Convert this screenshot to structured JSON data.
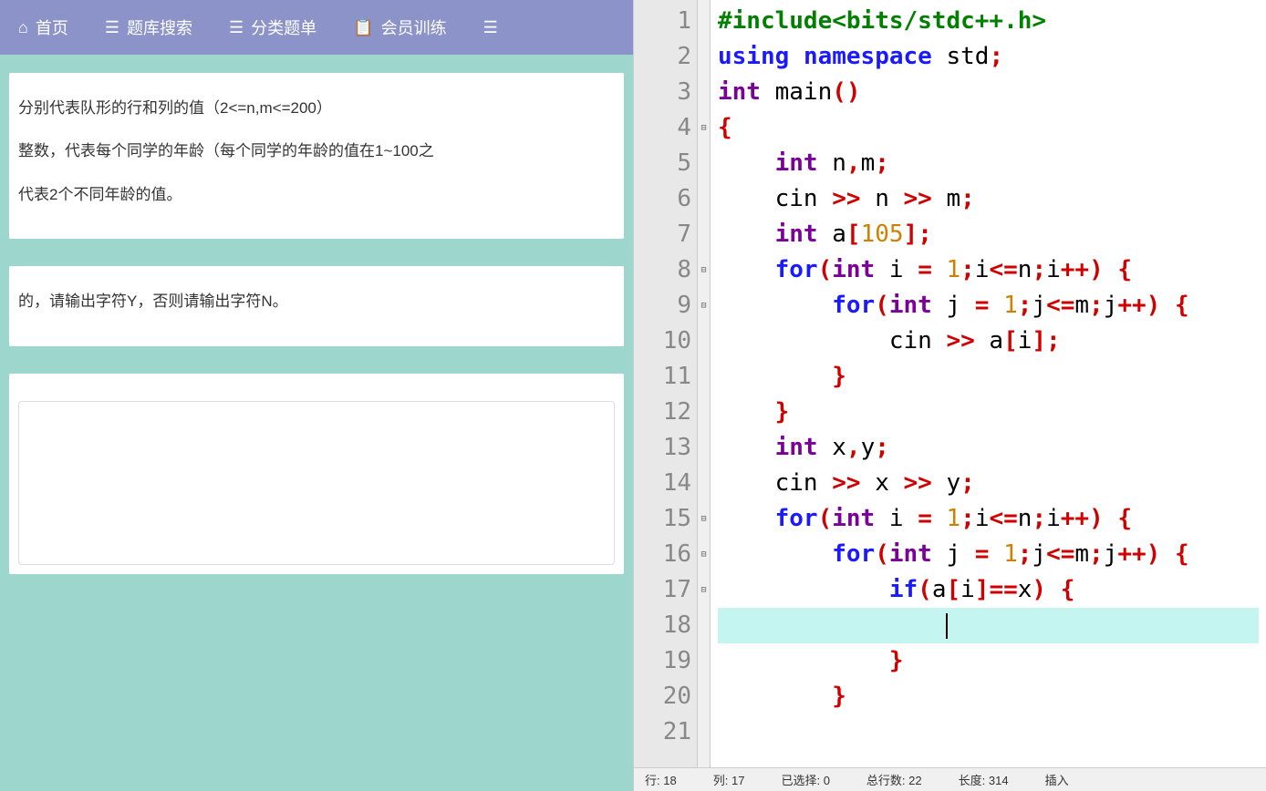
{
  "nav": {
    "items": [
      {
        "icon": "home",
        "label": "首页"
      },
      {
        "icon": "list",
        "label": "题库搜索"
      },
      {
        "icon": "list",
        "label": "分类题单"
      },
      {
        "icon": "calendar",
        "label": "会员训练"
      },
      {
        "icon": "list",
        "label": ""
      }
    ]
  },
  "problem": {
    "desc1": "分别代表队形的行和列的值（2<=n,m<=200）",
    "desc2": "整数，代表每个同学的年龄（每个同学的年龄的值在1~100之",
    "desc3": "代表2个不同年龄的值。",
    "output": "的，请输出字符Y，否则请输出字符N。"
  },
  "code": {
    "lines": [
      {
        "n": "1",
        "fold": "",
        "tokens": [
          [
            "pp",
            "#include"
          ],
          [
            "pp",
            "<bits/stdc++.h>"
          ]
        ]
      },
      {
        "n": "2",
        "fold": "",
        "tokens": [
          [
            "kw",
            "using"
          ],
          [
            "id",
            " "
          ],
          [
            "kw",
            "namespace"
          ],
          [
            "id",
            " std"
          ],
          [
            "op",
            ";"
          ]
        ]
      },
      {
        "n": "3",
        "fold": "",
        "tokens": [
          [
            "ty",
            "int"
          ],
          [
            "id",
            " main"
          ],
          [
            "br",
            "()"
          ]
        ]
      },
      {
        "n": "4",
        "fold": "⊟",
        "tokens": [
          [
            "br",
            "{"
          ]
        ]
      },
      {
        "n": "5",
        "fold": "",
        "tokens": [
          [
            "id",
            "    "
          ],
          [
            "ty",
            "int"
          ],
          [
            "id",
            " n"
          ],
          [
            "op",
            ","
          ],
          [
            "id",
            "m"
          ],
          [
            "op",
            ";"
          ]
        ]
      },
      {
        "n": "6",
        "fold": "",
        "tokens": [
          [
            "id",
            "    cin "
          ],
          [
            "op",
            ">>"
          ],
          [
            "id",
            " n "
          ],
          [
            "op",
            ">>"
          ],
          [
            "id",
            " m"
          ],
          [
            "op",
            ";"
          ]
        ]
      },
      {
        "n": "7",
        "fold": "",
        "tokens": [
          [
            "id",
            "    "
          ],
          [
            "ty",
            "int"
          ],
          [
            "id",
            " a"
          ],
          [
            "br",
            "["
          ],
          [
            "nm",
            "105"
          ],
          [
            "br",
            "]"
          ],
          [
            "op",
            ";"
          ]
        ]
      },
      {
        "n": "8",
        "fold": "⊟",
        "tokens": [
          [
            "id",
            "    "
          ],
          [
            "kw",
            "for"
          ],
          [
            "br",
            "("
          ],
          [
            "ty",
            "int"
          ],
          [
            "id",
            " i "
          ],
          [
            "op",
            "="
          ],
          [
            "id",
            " "
          ],
          [
            "nm",
            "1"
          ],
          [
            "op",
            ";"
          ],
          [
            "id",
            "i"
          ],
          [
            "op",
            "<="
          ],
          [
            "id",
            "n"
          ],
          [
            "op",
            ";"
          ],
          [
            "id",
            "i"
          ],
          [
            "op",
            "++"
          ],
          [
            "br",
            ")"
          ],
          [
            "id",
            " "
          ],
          [
            "br",
            "{"
          ]
        ]
      },
      {
        "n": "9",
        "fold": "⊟",
        "tokens": [
          [
            "id",
            "        "
          ],
          [
            "kw",
            "for"
          ],
          [
            "br",
            "("
          ],
          [
            "ty",
            "int"
          ],
          [
            "id",
            " j "
          ],
          [
            "op",
            "="
          ],
          [
            "id",
            " "
          ],
          [
            "nm",
            "1"
          ],
          [
            "op",
            ";"
          ],
          [
            "id",
            "j"
          ],
          [
            "op",
            "<="
          ],
          [
            "id",
            "m"
          ],
          [
            "op",
            ";"
          ],
          [
            "id",
            "j"
          ],
          [
            "op",
            "++"
          ],
          [
            "br",
            ")"
          ],
          [
            "id",
            " "
          ],
          [
            "br",
            "{"
          ]
        ]
      },
      {
        "n": "10",
        "fold": "",
        "tokens": [
          [
            "id",
            "            cin "
          ],
          [
            "op",
            ">>"
          ],
          [
            "id",
            " a"
          ],
          [
            "br",
            "["
          ],
          [
            "id",
            "i"
          ],
          [
            "br",
            "]"
          ],
          [
            "op",
            ";"
          ]
        ]
      },
      {
        "n": "11",
        "fold": "",
        "tokens": [
          [
            "id",
            "        "
          ],
          [
            "br",
            "}"
          ]
        ]
      },
      {
        "n": "12",
        "fold": "",
        "tokens": [
          [
            "id",
            "    "
          ],
          [
            "br",
            "}"
          ]
        ]
      },
      {
        "n": "13",
        "fold": "",
        "tokens": [
          [
            "id",
            "    "
          ],
          [
            "ty",
            "int"
          ],
          [
            "id",
            " x"
          ],
          [
            "op",
            ","
          ],
          [
            "id",
            "y"
          ],
          [
            "op",
            ";"
          ]
        ]
      },
      {
        "n": "14",
        "fold": "",
        "tokens": [
          [
            "id",
            "    cin "
          ],
          [
            "op",
            ">>"
          ],
          [
            "id",
            " x "
          ],
          [
            "op",
            ">>"
          ],
          [
            "id",
            " y"
          ],
          [
            "op",
            ";"
          ]
        ]
      },
      {
        "n": "15",
        "fold": "⊟",
        "tokens": [
          [
            "id",
            "    "
          ],
          [
            "kw",
            "for"
          ],
          [
            "br",
            "("
          ],
          [
            "ty",
            "int"
          ],
          [
            "id",
            " i "
          ],
          [
            "op",
            "="
          ],
          [
            "id",
            " "
          ],
          [
            "nm",
            "1"
          ],
          [
            "op",
            ";"
          ],
          [
            "id",
            "i"
          ],
          [
            "op",
            "<="
          ],
          [
            "id",
            "n"
          ],
          [
            "op",
            ";"
          ],
          [
            "id",
            "i"
          ],
          [
            "op",
            "++"
          ],
          [
            "br",
            ")"
          ],
          [
            "id",
            " "
          ],
          [
            "br",
            "{"
          ]
        ]
      },
      {
        "n": "16",
        "fold": "⊟",
        "tokens": [
          [
            "id",
            "        "
          ],
          [
            "kw",
            "for"
          ],
          [
            "br",
            "("
          ],
          [
            "ty",
            "int"
          ],
          [
            "id",
            " j "
          ],
          [
            "op",
            "="
          ],
          [
            "id",
            " "
          ],
          [
            "nm",
            "1"
          ],
          [
            "op",
            ";"
          ],
          [
            "id",
            "j"
          ],
          [
            "op",
            "<="
          ],
          [
            "id",
            "m"
          ],
          [
            "op",
            ";"
          ],
          [
            "id",
            "j"
          ],
          [
            "op",
            "++"
          ],
          [
            "br",
            ")"
          ],
          [
            "id",
            " "
          ],
          [
            "br",
            "{"
          ]
        ]
      },
      {
        "n": "17",
        "fold": "⊟",
        "tokens": [
          [
            "id",
            "            "
          ],
          [
            "kw",
            "if"
          ],
          [
            "br",
            "("
          ],
          [
            "id",
            "a"
          ],
          [
            "br",
            "["
          ],
          [
            "id",
            "i"
          ],
          [
            "br",
            "]"
          ],
          [
            "op",
            "=="
          ],
          [
            "id",
            "x"
          ],
          [
            "br",
            ")"
          ],
          [
            "id",
            " "
          ],
          [
            "br",
            "{"
          ]
        ]
      },
      {
        "n": "18",
        "fold": "",
        "highlight": true,
        "tokens": [
          [
            "id",
            "                "
          ],
          [
            "cursor",
            ""
          ]
        ]
      },
      {
        "n": "19",
        "fold": "",
        "tokens": [
          [
            "id",
            "            "
          ],
          [
            "br",
            "}"
          ]
        ]
      },
      {
        "n": "20",
        "fold": "",
        "tokens": [
          [
            "id",
            "        "
          ],
          [
            "br",
            "}"
          ]
        ]
      },
      {
        "n": "21",
        "fold": "",
        "tokens": [
          [
            "id",
            "    "
          ],
          [
            "br",
            ""
          ]
        ]
      }
    ]
  },
  "status": {
    "row_label": "行:",
    "row": "18",
    "col_label": "列:",
    "col": "17",
    "sel_label": "已选择:",
    "sel": "0",
    "lines_label": "总行数:",
    "lines": "22",
    "len_label": "长度:",
    "len": "314",
    "mode": "插入"
  }
}
